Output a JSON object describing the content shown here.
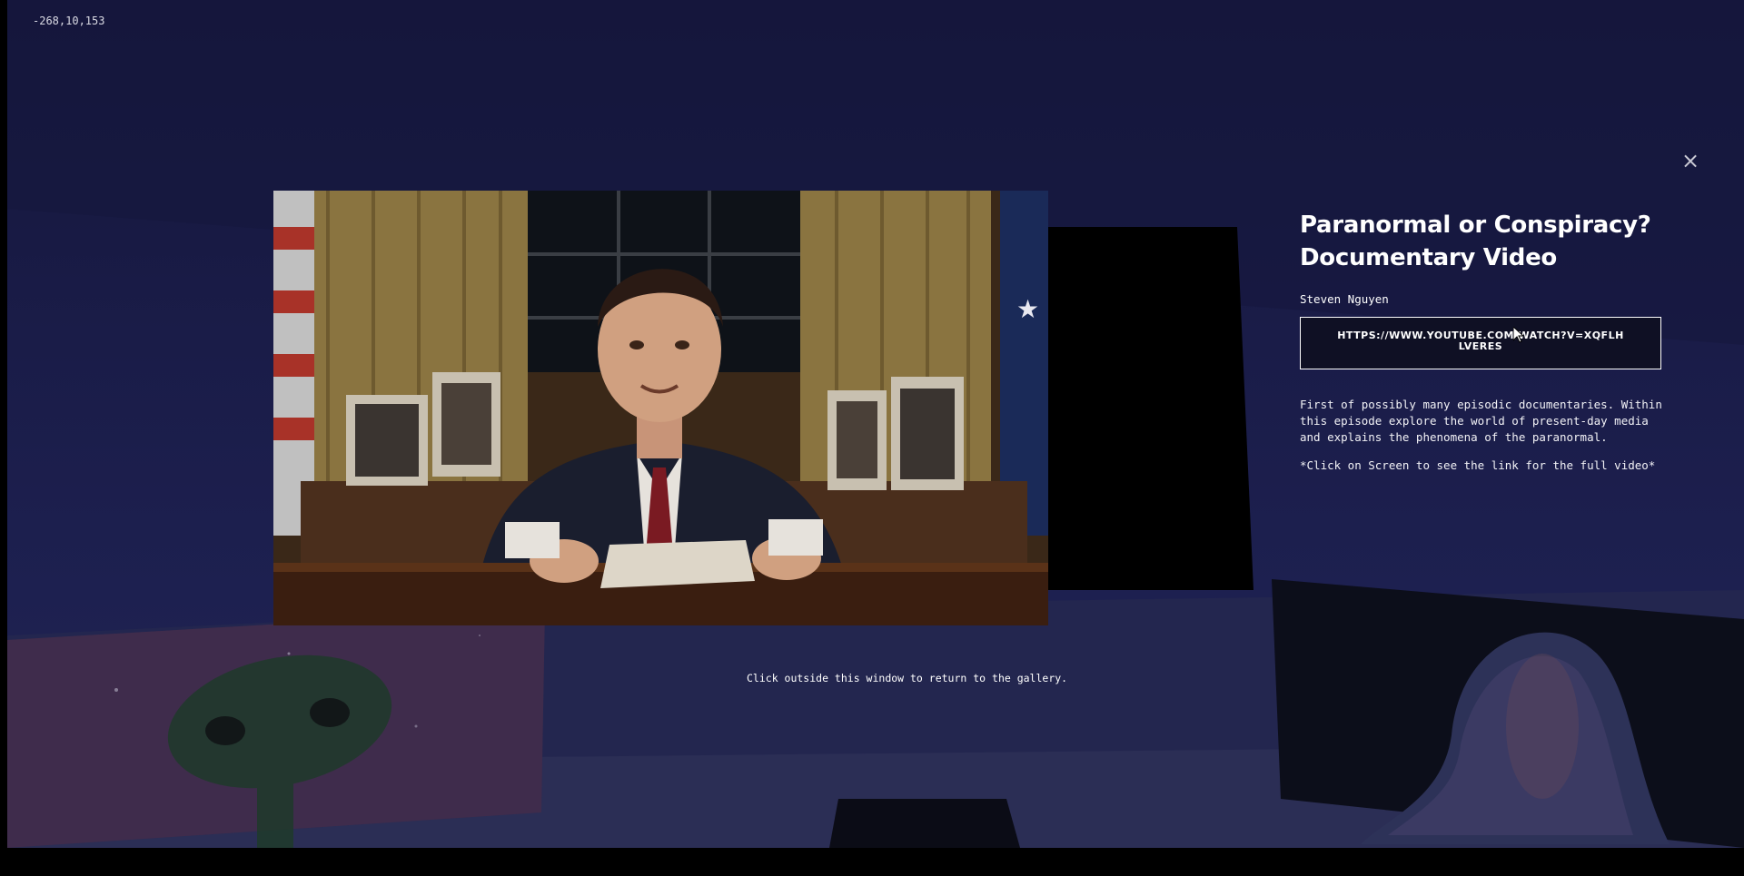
{
  "viewer": {
    "coordinates": "-268,10,153",
    "close_symbol": "×"
  },
  "artwork": {
    "title": "Paranormal or Conspiracy? Documentary Video",
    "author": "Steven Nguyen",
    "link_label": "HTTPS://WWW.YOUTUBE.COM/WATCH?V=XQFLHLVERES",
    "description": "First of possibly many episodic documentaries. Within this episode explore the world of present-day media and explains the phenomena of the paranormal.",
    "hint": "*Click on Screen to see the link for the full video*"
  },
  "footer": {
    "return_text": "Click outside this window to return to the gallery."
  },
  "colors": {
    "background": "#1a1c48",
    "text": "#ffffff",
    "button_border": "#ffffff"
  }
}
